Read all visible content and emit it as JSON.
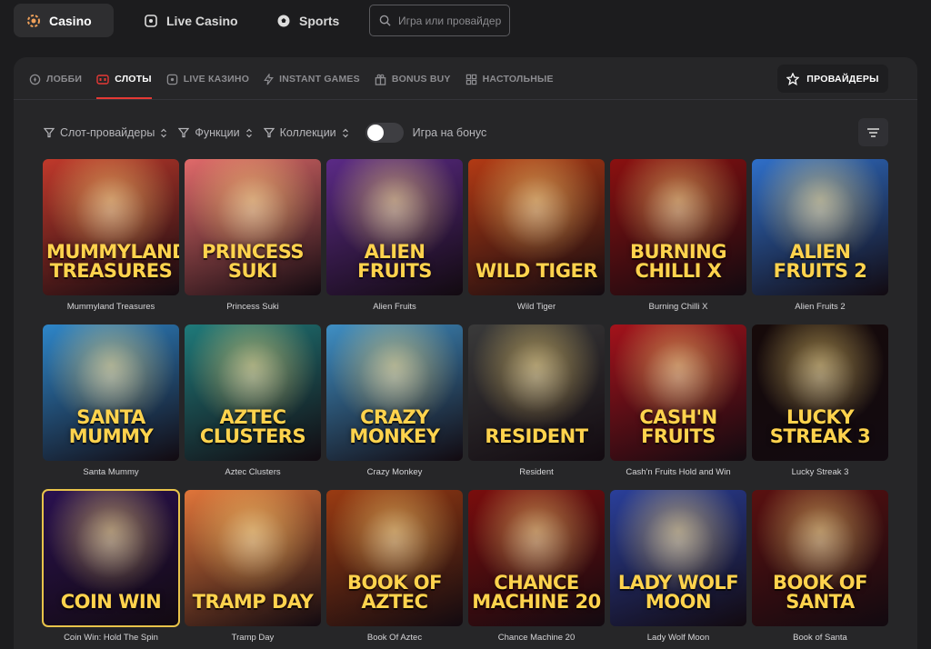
{
  "topnav": {
    "tabs": [
      {
        "label": "Casino",
        "icon": "casino-chip-icon",
        "active": true
      },
      {
        "label": "Live Casino",
        "icon": "live-casino-icon",
        "active": false
      },
      {
        "label": "Sports",
        "icon": "soccer-ball-icon",
        "active": false
      }
    ],
    "search_placeholder": "Игра или провайдер"
  },
  "categories": [
    {
      "label": "ЛОББИ",
      "icon": "compass-icon",
      "active": false
    },
    {
      "label": "СЛОТЫ",
      "icon": "slot-machine-icon",
      "active": true
    },
    {
      "label": "LIVE КАЗИНО",
      "icon": "live-icon",
      "active": false
    },
    {
      "label": "INSTANT GAMES",
      "icon": "lightning-icon",
      "active": false
    },
    {
      "label": "BONUS BUY",
      "icon": "gift-icon",
      "active": false
    },
    {
      "label": "НАСТОЛЬНЫЕ",
      "icon": "grid-icon",
      "active": false
    }
  ],
  "providers_button": "ПРОВАЙДЕРЫ",
  "filters": {
    "items": [
      "Слот-провайдеры",
      "Функции",
      "Коллекции"
    ],
    "toggle_label": "Игра на бонус",
    "toggle_on": false
  },
  "games": [
    {
      "name": "Mummyland Treasures",
      "art": "MUMMYLAND TREASURES",
      "bg": "#c0392b"
    },
    {
      "name": "Princess Suki",
      "art": "PRINCESS SUKI",
      "bg": "#e06a6a"
    },
    {
      "name": "Alien Fruits",
      "art": "ALIEN FRUITS",
      "bg": "#5b2a86"
    },
    {
      "name": "Wild Tiger",
      "art": "WILD TIGER",
      "bg": "#b23a14"
    },
    {
      "name": "Burning Chilli X",
      "art": "BURNING CHILLI X",
      "bg": "#8b1010"
    },
    {
      "name": "Alien Fruits 2",
      "art": "ALIEN FRUITS 2",
      "bg": "#2f6fc9"
    },
    {
      "name": "Santa Mummy",
      "art": "SANTA MUMMY",
      "bg": "#2e86c9"
    },
    {
      "name": "Aztec Clusters",
      "art": "AZTEC CLUSTERS",
      "bg": "#1f7a7a"
    },
    {
      "name": "Crazy Monkey",
      "art": "CRAZY MONKEY",
      "bg": "#3f8fc4"
    },
    {
      "name": "Resident",
      "art": "RESIDENT",
      "bg": "#3a3a3a"
    },
    {
      "name": "Cash'n Fruits Hold and Win",
      "art": "CASH'N FRUITS",
      "bg": "#a3121b"
    },
    {
      "name": "Lucky Streak 3",
      "art": "LUCKY STREAK 3",
      "bg": "#160a0a"
    },
    {
      "name": "Coin Win: Hold The Spin",
      "art": "COIN WIN",
      "bg": "#2a1150",
      "selected": true
    },
    {
      "name": "Tramp Day",
      "art": "TRAMP DAY",
      "bg": "#e0753a"
    },
    {
      "name": "Book Of Aztec",
      "art": "BOOK OF AZTEC",
      "bg": "#9a3b12"
    },
    {
      "name": "Chance Machine 20",
      "art": "CHANCE MACHINE 20",
      "bg": "#7a0d0d"
    },
    {
      "name": "Lady Wolf Moon",
      "art": "LADY WOLF MOON",
      "bg": "#2a3f9a"
    },
    {
      "name": "Book of Santa",
      "art": "BOOK OF SANTA",
      "bg": "#5a1010"
    }
  ],
  "colors": {
    "accent": "#e53935",
    "panel": "#262628",
    "background": "#1c1c1e"
  }
}
